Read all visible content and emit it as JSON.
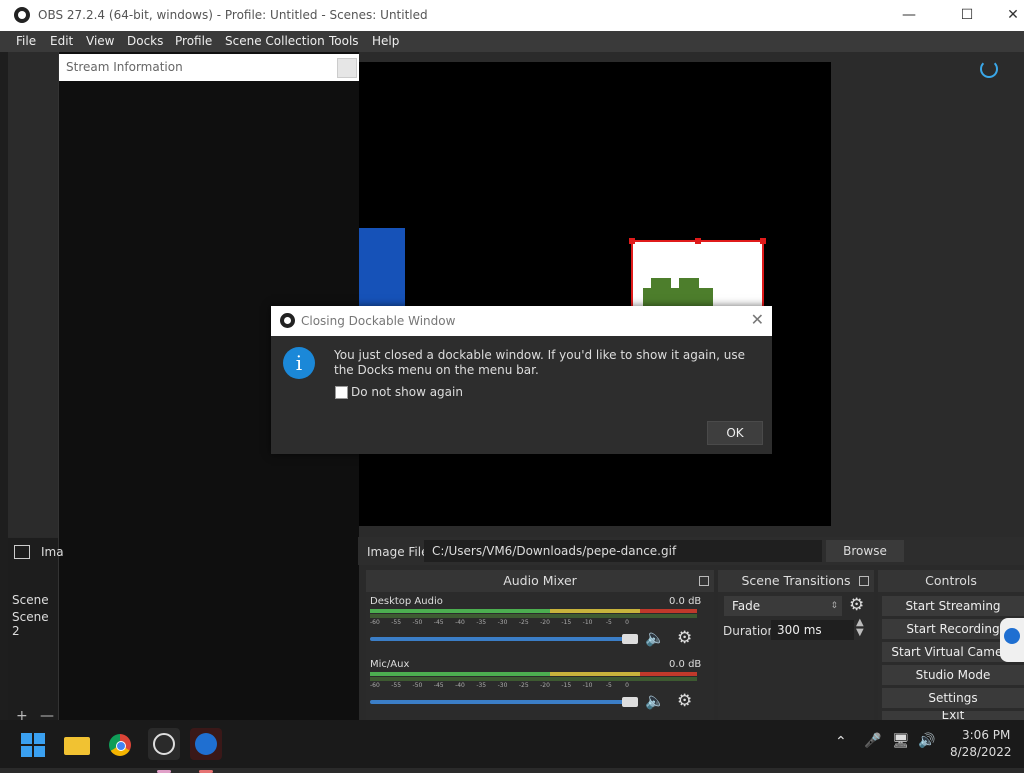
{
  "window": {
    "title": "OBS 27.2.4 (64-bit, windows) - Profile: Untitled - Scenes: Untitled",
    "minimize_icon": "minimize-icon",
    "maximize_icon": "maximize-icon",
    "close_icon": "close-icon"
  },
  "menu": [
    "File",
    "Edit",
    "View",
    "Docks",
    "Profile",
    "Scene Collection",
    "Tools",
    "Help"
  ],
  "dock": {
    "title": "Stream Information"
  },
  "sources": {
    "image_label_partial": "Ima",
    "file_label": "Image File",
    "file_value": "C:/Users/VM6/Downloads/pepe-dance.gif",
    "browse_label": "Browse"
  },
  "scenes": {
    "items": [
      "Scene",
      "Scene 2"
    ]
  },
  "audio_mixer": {
    "title": "Audio Mixer",
    "channels": [
      {
        "name": "Desktop Audio",
        "db": "0.0 dB"
      },
      {
        "name": "Mic/Aux",
        "db": "0.0 dB"
      }
    ],
    "ticks": [
      "-60",
      "-55",
      "-50",
      "-45",
      "-40",
      "-35",
      "-30",
      "-25",
      "-20",
      "-15",
      "-10",
      "-5",
      "0"
    ]
  },
  "transitions": {
    "title": "Scene Transitions",
    "selected": "Fade",
    "duration_label": "Duration",
    "duration_value": "300 ms"
  },
  "controls": {
    "title": "Controls",
    "buttons": [
      "Start Streaming",
      "Start Recording",
      "Start Virtual Camera",
      "Studio Mode",
      "Settings",
      "Exit"
    ]
  },
  "dialog": {
    "title": "Closing Dockable Window",
    "message": "You just closed a dockable window. If you'd like to show it again, use the Docks menu on the menu bar.",
    "checkbox_label": "Do not show again",
    "ok_label": "OK"
  },
  "taskbar": {
    "time": "3:06 PM",
    "date": "8/28/2022"
  },
  "colors": {
    "accent": "#1b88d8",
    "selection": "#e01b1b",
    "meter_green": "#4caf50",
    "meter_yellow": "#c8b43c",
    "meter_red": "#c0392b"
  }
}
